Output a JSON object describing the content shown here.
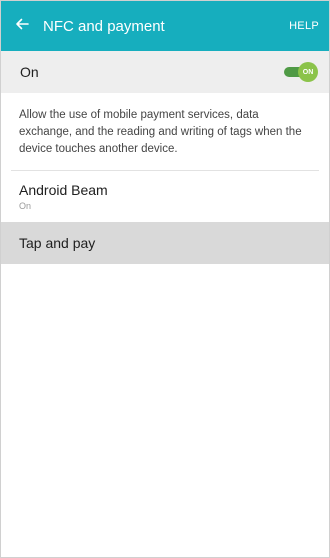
{
  "header": {
    "back_icon": "arrow-left-icon",
    "title": "NFC and payment",
    "help_label": "HELP",
    "background_color": "#16aebe"
  },
  "master_switch": {
    "label": "On",
    "state_text": "ON",
    "enabled": true,
    "accent_color": "#8bc34a"
  },
  "description": "Allow the use of mobile payment services, data exchange, and the reading and writing of tags when the device touches another device.",
  "items": [
    {
      "title": "Android Beam",
      "subtitle": "On"
    },
    {
      "title": "Tap and pay",
      "highlighted": true
    }
  ]
}
